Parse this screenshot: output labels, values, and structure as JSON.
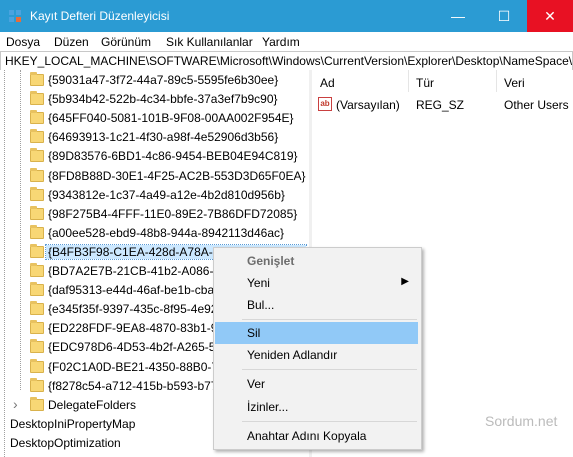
{
  "window": {
    "title": "Kayıt Defteri Düzenleyicisi",
    "minimize": "—",
    "maximize": "☐",
    "close": "✕"
  },
  "menu": [
    "Dosya",
    "Düzen",
    "Görünüm",
    "Sık Kullanılanlar",
    "Yardım"
  ],
  "address": "HKEY_LOCAL_MACHINE\\SOFTWARE\\Microsoft\\Windows\\CurrentVersion\\Explorer\\Desktop\\NameSpace\\{B",
  "tree": {
    "guid_keys": [
      "{59031a47-3f72-44a7-89c5-5595fe6b30ee}",
      "{5b934b42-522b-4c34-bbfe-37a3ef7b9c90}",
      "{645FF040-5081-101B-9F08-00AA002F954E}",
      "{64693913-1c21-4f30-a98f-4e52906d3b56}",
      "{89D83576-6BD1-4c86-9454-BEB04E94C819}",
      "{8FD8B88D-30E1-4F25-AC2B-553D3D65F0EA}",
      "{9343812e-1c37-4a49-a12e-4b2d810d956b}",
      "{98F275B4-4FFF-11E0-89E2-7B86DFD72085}",
      "{a00ee528-ebd9-48b8-944a-8942113d46ac}",
      "{B4FB3F98-C1EA-428d-A78A-D1F5659CBA93}",
      "{BD7A2E7B-21CB-41b2-A086-B",
      "{daf95313-e44d-46af-be1b-cba",
      "{e345f35f-9397-435c-8f95-4e92",
      "{ED228FDF-9EA8-4870-83b1-96",
      "{EDC978D6-4D53-4b2f-A265-58",
      "{F02C1A0D-BE21-4350-88B0-73",
      "{f8278c54-a712-415b-b593-b77"
    ],
    "selected_key": "{B4FB3F98-C1EA-428d-A78A-D1F5659CBA93}",
    "delegate_folders": "DelegateFolders",
    "sibling_keys": [
      "DesktopIniPropertyMap",
      "DesktopOptimization"
    ]
  },
  "list": {
    "columns": [
      "Ad",
      "Tür",
      "Veri"
    ],
    "rows": [
      {
        "name": "(Varsayılan)",
        "type": "REG_SZ",
        "data": "Other Users"
      }
    ],
    "value_icon": "ab-string-icon"
  },
  "context_menu": {
    "expand": "Genişlet",
    "new": "Yeni",
    "find": "Bul...",
    "delete": "Sil",
    "rename": "Yeniden Adlandır",
    "export": "Ver",
    "permissions": "İzinler...",
    "copy_key_name": "Anahtar Adını Kopyala",
    "highlighted": "Sil"
  },
  "watermark": "Sordum.net",
  "colors": {
    "titlebar": "#2b9bd3",
    "close_button": "#e81123",
    "menu_highlight": "#91c9f7",
    "folder": "#f8d775"
  }
}
